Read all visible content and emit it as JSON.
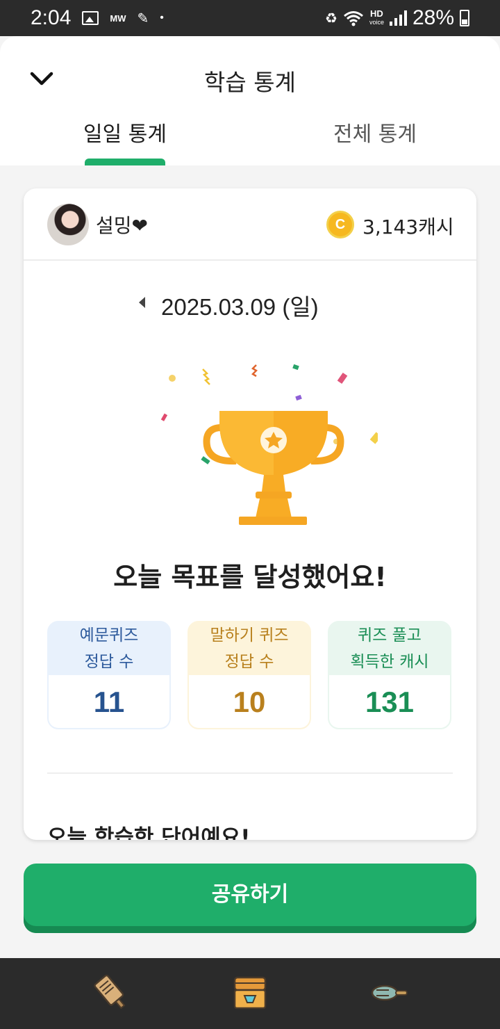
{
  "status_bar": {
    "time": "2:04",
    "mw": "MW",
    "dot": "•",
    "hd": "HD",
    "hd_sub": "voice",
    "battery_pct": "28%"
  },
  "header": {
    "title": "학습 통계",
    "tabs": [
      {
        "label": "일일 통계",
        "active": true
      },
      {
        "label": "전체 통계",
        "active": false
      }
    ]
  },
  "profile": {
    "username": "설밍❤",
    "cash": "3,143캐시",
    "coin_symbol": "C"
  },
  "date": "2025.03.09 (일)",
  "goal_message": "오늘 목표를 달성했어요!",
  "stats": [
    {
      "label_line1": "예문퀴즈",
      "label_line2": "정답 수",
      "value": "11",
      "color": "#27538f"
    },
    {
      "label_line1": "말하기 퀴즈",
      "label_line2": "정답 수",
      "value": "10",
      "color": "#b9801e"
    },
    {
      "label_line1": "퀴즈 풀고",
      "label_line2": "획득한 캐시",
      "value": "131",
      "color": "#1a8e55"
    }
  ],
  "words_heading": "오늘 학습한 단어예요!",
  "share_button": "공유하기",
  "accent": "#1fae6a",
  "bottom_nav": [
    "vocab-card-icon",
    "treasure-chest-icon",
    "fork-icon"
  ]
}
